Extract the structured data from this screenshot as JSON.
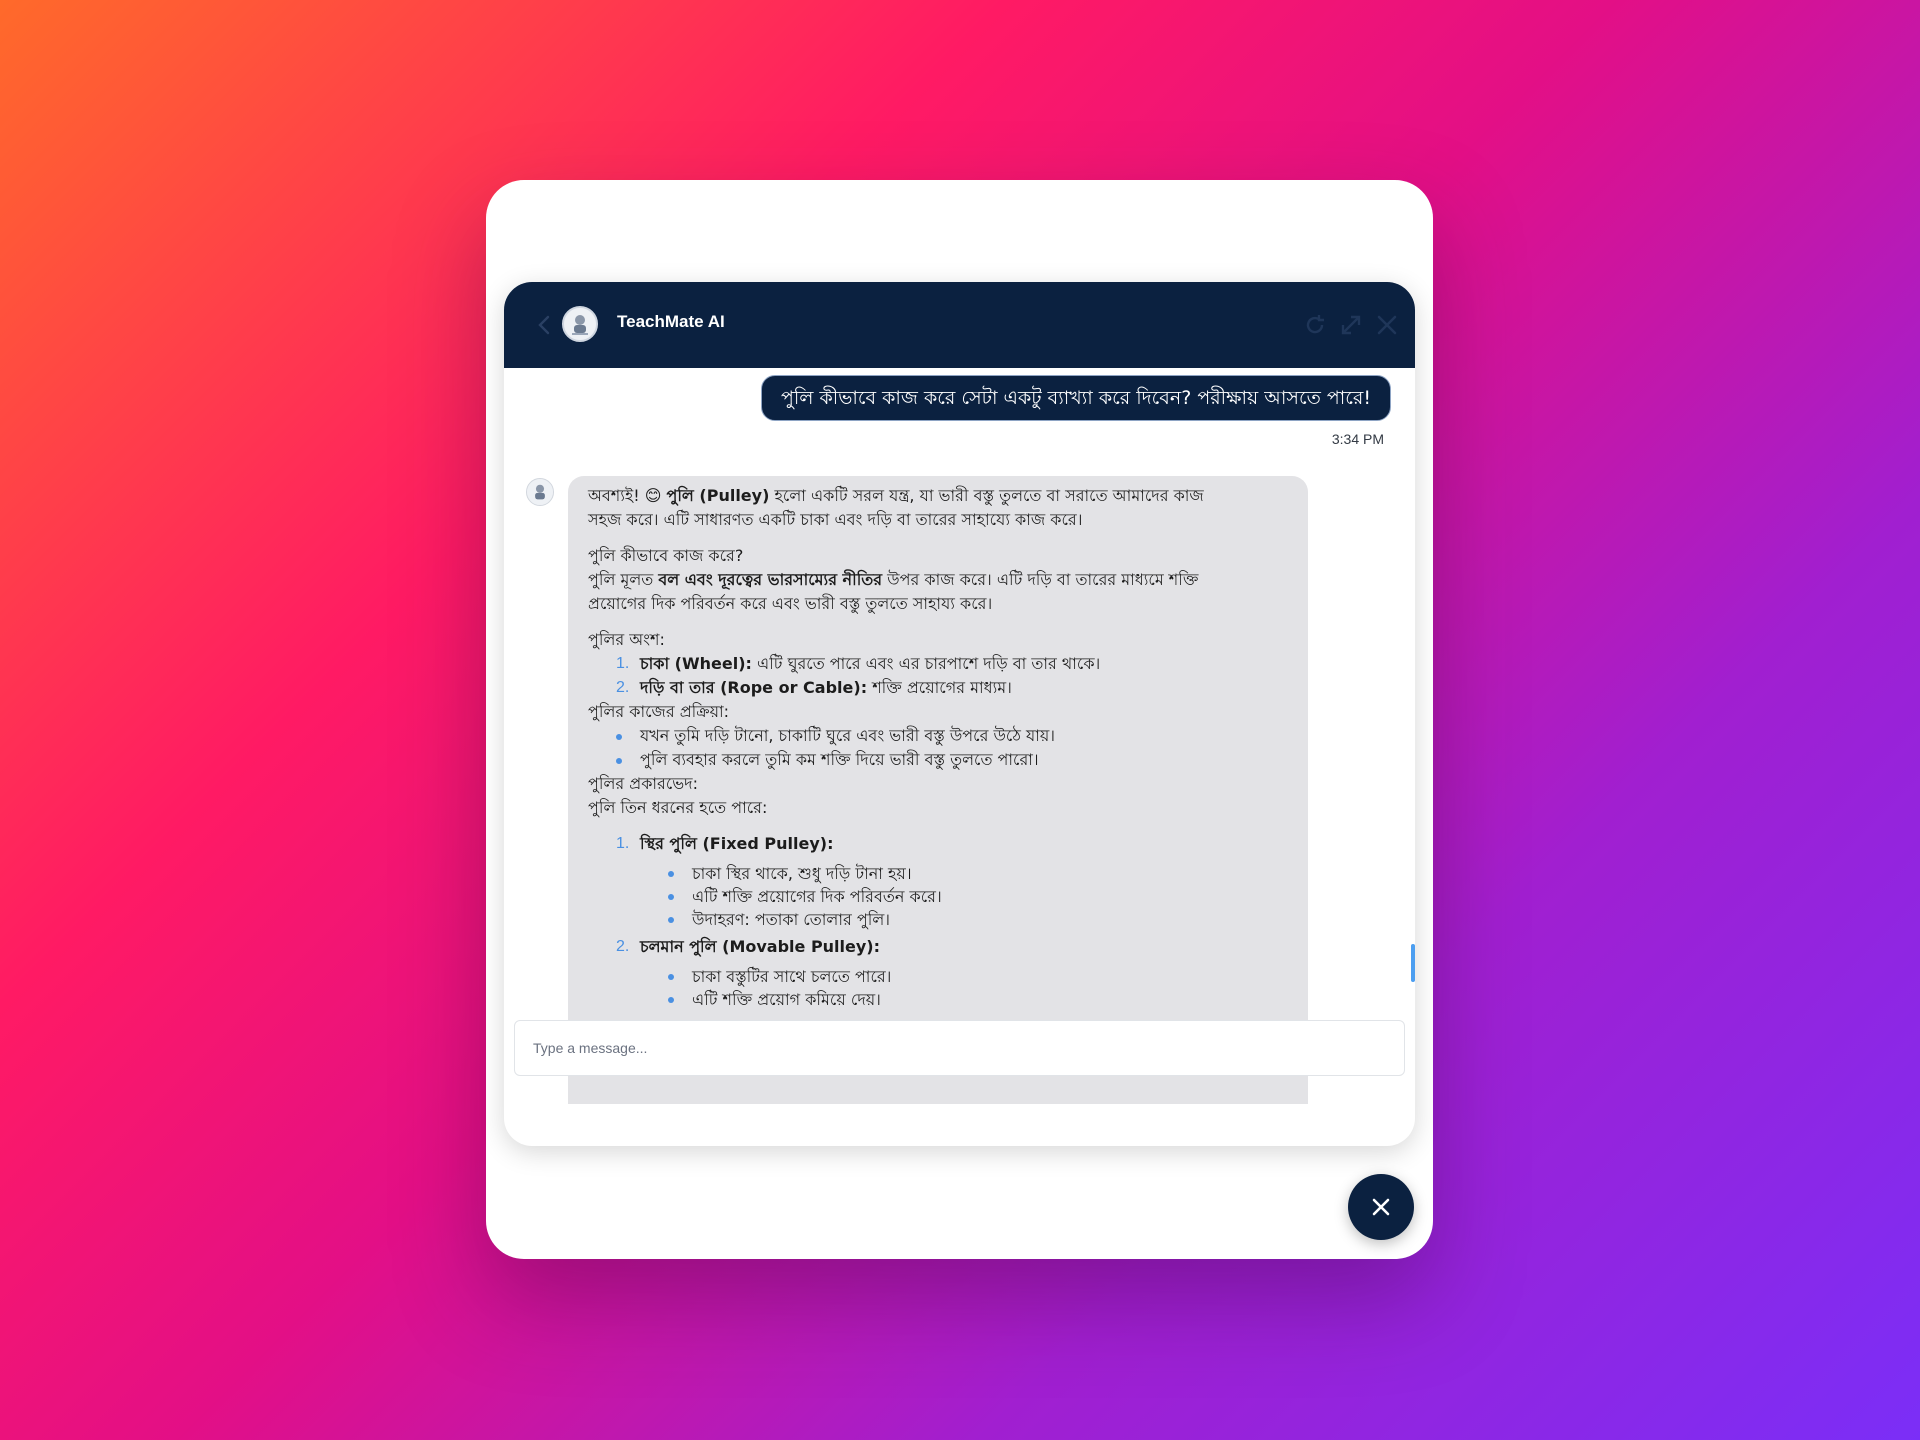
{
  "header": {
    "title": "TeachMate AI",
    "back_icon": "chevron-left-icon",
    "actions": [
      "refresh-icon",
      "expand-icon",
      "close-icon"
    ]
  },
  "conversation": {
    "user_message": "পুলি কীভাবে কাজ করে সেটা একটু ব্যাখ্যা করে দিবেন? পরীক্ষায় আসতে পারে!",
    "user_time": "3:34 PM",
    "bot": {
      "intro_a": "অবশ্যই! 😊 ",
      "intro_b": "পুলি (Pulley)",
      "intro_c": " হলো একটি সরল যন্ত্র, যা ভারী বস্তু তুলতে বা সরাতে আমাদের কাজ",
      "intro_d": "সহজ করে। এটি সাধারণত একটি চাকা এবং দড়ি বা তারের সাহায্যে কাজ করে।",
      "how_heading": "পুলি কীভাবে কাজ করে?",
      "how_a": "পুলি মূলত ",
      "how_b": "বল এবং দূরত্বের ভারসাম্যের নীতির",
      "how_c": " উপর কাজ করে। এটি দড়ি বা তারের মাধ্যমে শক্তি",
      "how_d": "প্রয়োগের দিক পরিবর্তন করে এবং ভারী বস্তু তুলতে সাহায্য করে।",
      "parts_heading": "পুলির অংশ:",
      "parts": [
        {
          "marker": "1.",
          "bold": "চাকা (Wheel):",
          "text": " এটি ঘুরতে পারে এবং এর চারপাশে দড়ি বা তার থাকে।"
        },
        {
          "marker": "2.",
          "bold": "দড়ি বা তার (Rope or Cable):",
          "text": " শক্তি প্রয়োগের মাধ্যম।"
        }
      ],
      "process_heading": "পুলির কাজের প্রক্রিয়া:",
      "process": [
        "যখন তুমি দড়ি টানো, চাকাটি ঘুরে এবং ভারী বস্তু উপরে উঠে যায়।",
        "পুলি ব্যবহার করলে তুমি কম শক্তি দিয়ে ভারী বস্তু তুলতে পারো।"
      ],
      "types_heading": "পুলির প্রকারভেদ:",
      "types_intro": "পুলি তিন ধরনের হতে পারে:",
      "types": [
        {
          "marker": "1.",
          "title": "স্থির পুলি (Fixed Pulley):",
          "points": [
            "চাকা স্থির থাকে, শুধু দড়ি টানা হয়।",
            "এটি শক্তি প্রয়োগের দিক পরিবর্তন করে।",
            "উদাহরণ: পতাকা তোলার পুলি।"
          ]
        },
        {
          "marker": "2.",
          "title": "চলমান পুলি (Movable Pulley):",
          "points": [
            "চাকা বস্তুটির সাথে চলতে পারে।",
            "এটি শক্তি প্রয়োগ কমিয়ে দেয়।"
          ]
        }
      ]
    }
  },
  "composer": {
    "placeholder": "Type a message..."
  },
  "launcher": {
    "icon": "close-icon"
  },
  "colors": {
    "header_bg": "#0b2140",
    "bot_bubble_bg": "#e3e3e6",
    "accent": "#4a90e2"
  }
}
